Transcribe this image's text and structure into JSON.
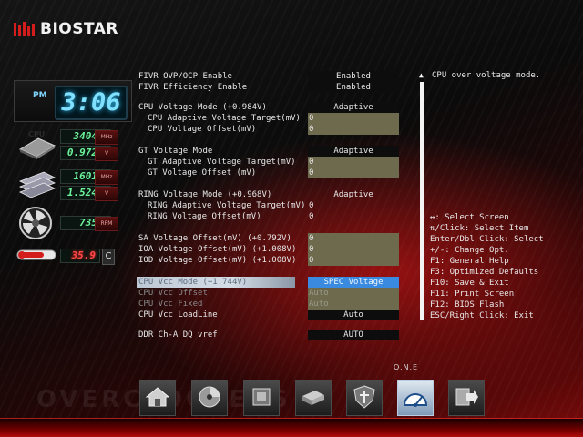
{
  "logo": {
    "brand": "BIOSTAR",
    "accent": "#d31c1c"
  },
  "status": {
    "ampm": "PM",
    "time": "3:06",
    "cpu_label": "CPU",
    "cpu_freq": "3404",
    "cpu_freq_unit": "MHz",
    "cpu_volt": "0.972",
    "cpu_volt_unit": "V",
    "mem_freq": "1601",
    "mem_freq_unit": "MHz",
    "mem_volt": "1.524",
    "mem_volt_unit": "V",
    "fan_rpm": "735",
    "fan_unit": "RPM",
    "temp": "35.9",
    "temp_unit": "C"
  },
  "menu": [
    {
      "id": "fivr-ovp",
      "label": "FIVR OVP/OCP Enable",
      "value": "Enabled",
      "style": "box"
    },
    {
      "id": "fivr-eff",
      "label": "FIVR Efficiency Enable",
      "value": "Enabled",
      "style": "box"
    },
    {
      "id": "cpu-vmode",
      "label": "CPU Voltage Mode (+0.984V)",
      "value": "Adaptive",
      "style": "box"
    },
    {
      "id": "cpu-avt",
      "label": "CPU Adaptive Voltage Target(mV)",
      "value": "0",
      "style": "olive",
      "indent": true
    },
    {
      "id": "cpu-vo",
      "label": "CPU Voltage Offset(mV)",
      "value": "0",
      "style": "olive",
      "indent": true
    },
    {
      "id": "gt-vmode",
      "label": "GT Voltage Mode",
      "value": "Adaptive",
      "style": "box"
    },
    {
      "id": "gt-avt",
      "label": "GT Adaptive Voltage Target(mV)",
      "value": "0",
      "style": "olive",
      "indent": true
    },
    {
      "id": "gt-vo",
      "label": "GT Voltage Offset (mV)",
      "value": "0",
      "style": "olive",
      "indent": true
    },
    {
      "id": "ring-vmode",
      "label": "RING Voltage Mode (+0.968V)",
      "value": "Adaptive",
      "style": "plain"
    },
    {
      "id": "ring-avt",
      "label": "RING Adaptive Voltage Target(mV)",
      "value": "0",
      "style": "plainleft",
      "indent": true
    },
    {
      "id": "ring-vo",
      "label": "RING Voltage Offset(mV)",
      "value": "0",
      "style": "plainleft",
      "indent": true
    },
    {
      "id": "sa-vo",
      "label": "SA Voltage Offset(mV) (+0.792V)",
      "value": "0",
      "style": "olive"
    },
    {
      "id": "ioa-vo",
      "label": "IOA Voltage Offset(mV) (+1.008V)",
      "value": "0",
      "style": "olive"
    },
    {
      "id": "iod-vo",
      "label": "IOD Voltage Offset(mV) (+1.008V)",
      "value": "0",
      "style": "olive"
    },
    {
      "id": "cpu-vcc-mode",
      "label": "CPU Vcc Mode (+1.744V)",
      "value": "SPEC Voltage",
      "style": "selected"
    },
    {
      "id": "cpu-vcc-offset",
      "label": "CPU Vcc Offset",
      "value": "Auto",
      "style": "dim"
    },
    {
      "id": "cpu-vcc-fixed",
      "label": "CPU Vcc Fixed",
      "value": "Auto",
      "style": "dim"
    },
    {
      "id": "cpu-vcc-loadline",
      "label": "CPU Vcc LoadLine",
      "value": "Auto",
      "style": "box"
    },
    {
      "id": "ddr-dq-vref",
      "label": "DDR Ch-A DQ vref",
      "value": "AUTO",
      "style": "box"
    }
  ],
  "help": {
    "scroll_up": "▲",
    "description": "CPU over voltage mode.",
    "keys": [
      "↔: Select Screen",
      "⇅/Click: Select Item",
      "Enter/Dbl Click: Select",
      "+/-: Change Opt.",
      "F1: General Help",
      "F3: Optimized Defaults",
      "F10: Save & Exit",
      "F11: Print Screen",
      "F12: BIOS Flash",
      "ESC/Right Click: Exit"
    ]
  },
  "dock": {
    "label": "O.N.E",
    "watermark": "OVERCLOCKERS",
    "items": [
      {
        "id": "main",
        "icon": "home-icon"
      },
      {
        "id": "advanced",
        "icon": "disc-icon"
      },
      {
        "id": "chipset",
        "icon": "chip-icon"
      },
      {
        "id": "boot",
        "icon": "drive-icon"
      },
      {
        "id": "security",
        "icon": "shield-icon"
      },
      {
        "id": "one",
        "icon": "gauge-icon",
        "active": true
      },
      {
        "id": "save-exit",
        "icon": "exit-icon"
      }
    ]
  }
}
